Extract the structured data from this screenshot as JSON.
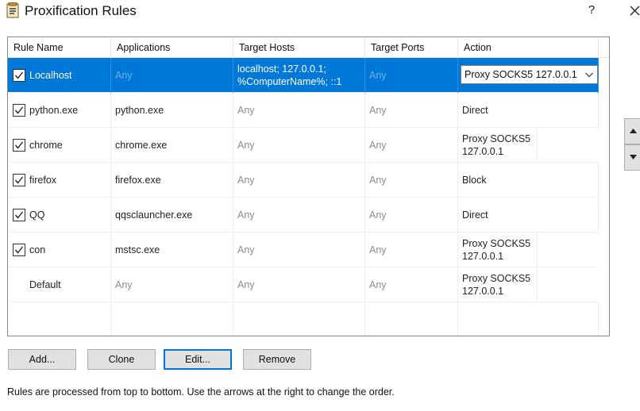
{
  "window": {
    "title": "Proxification Rules",
    "help_label": "?"
  },
  "table": {
    "columns": [
      "Rule Name",
      "Applications",
      "Target Hosts",
      "Target Ports",
      "Action"
    ],
    "rows": [
      {
        "checked": true,
        "name": "Localhost",
        "applications": "Any",
        "hosts": "localhost; 127.0.0.1; %ComputerName%; ::1",
        "ports": "Any",
        "action": "Proxy SOCKS5 127.0.0.1",
        "selected": true
      },
      {
        "checked": true,
        "name": "python.exe",
        "applications": "python.exe",
        "hosts": "Any",
        "ports": "Any",
        "action": "Direct"
      },
      {
        "checked": true,
        "name": "chrome",
        "applications": "chrome.exe",
        "hosts": "Any",
        "ports": "Any",
        "action": "Proxy SOCKS5 127.0.0.1"
      },
      {
        "checked": true,
        "name": "firefox",
        "applications": "firefox.exe",
        "hosts": "Any",
        "ports": "Any",
        "action": "Block"
      },
      {
        "checked": true,
        "name": "QQ",
        "applications": "qqsclauncher.exe",
        "hosts": "Any",
        "ports": "Any",
        "action": "Direct"
      },
      {
        "checked": true,
        "name": "con",
        "applications": "mstsc.exe",
        "hosts": "Any",
        "ports": "Any",
        "action": "Proxy SOCKS5 127.0.0.1"
      },
      {
        "checked": false,
        "name": "Default",
        "applications": "Any",
        "hosts": "Any",
        "ports": "Any",
        "action": "Proxy SOCKS5 127.0.0.1"
      }
    ]
  },
  "buttons": {
    "add": "Add...",
    "clone": "Clone",
    "edit": "Edit...",
    "remove": "Remove"
  },
  "footer_text": "Rules are processed from top to bottom. Use the arrows at the right to change the order.",
  "colors": {
    "selection": "#0078d7",
    "button_face": "#e1e1e1",
    "muted_text": "#8c8c8c"
  }
}
